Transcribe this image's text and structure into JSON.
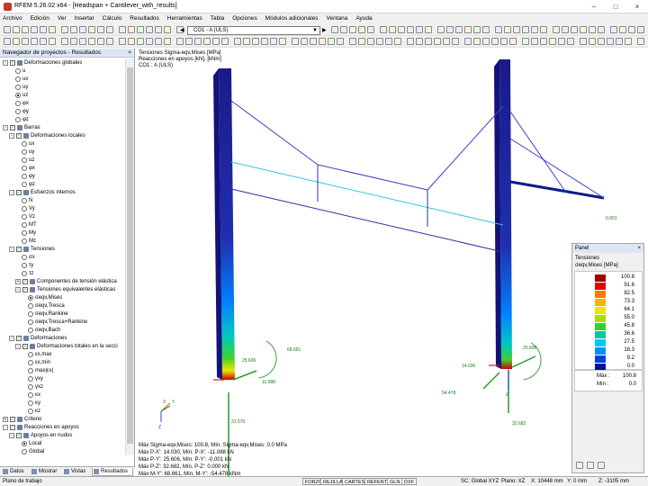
{
  "window": {
    "title": "RFEM 5.26.02 x64 - [Headspan + Cantilever_with_results]"
  },
  "menu": [
    "Archivo",
    "Edición",
    "Ver",
    "Insertar",
    "Cálculo",
    "Resultados",
    "Herramientas",
    "Tabla",
    "Opciones",
    "Módulos adicionales",
    "Ventana",
    "Ayuda"
  ],
  "toolbar": {
    "loadcase": "CO1 - A (ULS)"
  },
  "navigator": {
    "title": "Navegador de proyectos - Resultados",
    "items": [
      {
        "label": "Deformaciones globales",
        "level": 0,
        "exp": "-",
        "cb": true
      },
      {
        "label": "u",
        "level": 2,
        "radio": true
      },
      {
        "label": "ux",
        "level": 2,
        "radio": true
      },
      {
        "label": "uy",
        "level": 2,
        "radio": true
      },
      {
        "label": "uz",
        "level": 2,
        "radio": true,
        "on": true
      },
      {
        "label": "φx",
        "level": 2,
        "radio": true
      },
      {
        "label": "φy",
        "level": 2,
        "radio": true
      },
      {
        "label": "φz",
        "level": 2,
        "radio": true
      },
      {
        "label": "Barras",
        "level": 0,
        "exp": "-",
        "cb": true
      },
      {
        "label": "Deformaciones locales",
        "level": 1,
        "exp": "-",
        "cb": true
      },
      {
        "label": "ux",
        "level": 3,
        "radio": true
      },
      {
        "label": "uy",
        "level": 3,
        "radio": true
      },
      {
        "label": "uz",
        "level": 3,
        "radio": true
      },
      {
        "label": "φx",
        "level": 3,
        "radio": true
      },
      {
        "label": "φy",
        "level": 3,
        "radio": true
      },
      {
        "label": "φz",
        "level": 3,
        "radio": true
      },
      {
        "label": "Esfuerzos internos",
        "level": 1,
        "exp": "-",
        "cb": true
      },
      {
        "label": "N",
        "level": 3,
        "radio": true
      },
      {
        "label": "Vy",
        "level": 3,
        "radio": true
      },
      {
        "label": "Vz",
        "level": 3,
        "radio": true
      },
      {
        "label": "MT",
        "level": 3,
        "radio": true
      },
      {
        "label": "My",
        "level": 3,
        "radio": true
      },
      {
        "label": "Mz",
        "level": 3,
        "radio": true
      },
      {
        "label": "Tensiones",
        "level": 1,
        "exp": "-",
        "cb": true
      },
      {
        "label": "σx",
        "level": 3,
        "radio": true
      },
      {
        "label": "τy",
        "level": 3,
        "radio": true
      },
      {
        "label": "τz",
        "level": 3,
        "radio": true
      },
      {
        "label": "Componentes de tensión elástica",
        "level": 2,
        "exp": "+",
        "cb": true
      },
      {
        "label": "Tensiones equivalentes elásticas",
        "level": 2,
        "exp": "-",
        "cb": true
      },
      {
        "label": "σeqv,Mises",
        "level": 4,
        "radio": true,
        "on": true
      },
      {
        "label": "σeqv,Tresca",
        "level": 4,
        "radio": true
      },
      {
        "label": "σeqv,Rankine",
        "level": 4,
        "radio": true
      },
      {
        "label": "σeqv,Tresca+Rankine",
        "level": 4,
        "radio": true
      },
      {
        "label": "σeqv,Bach",
        "level": 4,
        "radio": true
      },
      {
        "label": "Deformaciones",
        "level": 1,
        "exp": "-",
        "cb": true
      },
      {
        "label": "Deformaciones totales en la secci",
        "level": 2,
        "exp": "-",
        "cb": true
      },
      {
        "label": "εx,max",
        "level": 4,
        "radio": true
      },
      {
        "label": "εx,min",
        "level": 4,
        "radio": true
      },
      {
        "label": "max|εx|",
        "level": 4,
        "radio": true
      },
      {
        "label": "γxy",
        "level": 4,
        "radio": true
      },
      {
        "label": "γxz",
        "level": 4,
        "radio": true
      },
      {
        "label": "κx",
        "level": 4,
        "radio": true
      },
      {
        "label": "κy",
        "level": 4,
        "radio": true
      },
      {
        "label": "κz",
        "level": 4,
        "radio": true
      },
      {
        "label": "Criterio",
        "level": 0,
        "exp": "+",
        "cb": true
      },
      {
        "label": "Reacciones en apoyos",
        "level": 0,
        "exp": "-",
        "cb": true
      },
      {
        "label": "Apoyos en nudos",
        "level": 1,
        "exp": "-",
        "cb": true
      },
      {
        "label": "Local",
        "level": 3,
        "radio": true,
        "on": true
      },
      {
        "label": "Global",
        "level": 3,
        "radio": true
      }
    ]
  },
  "navtabs": [
    "Datos",
    "Mostrar",
    "Vistas",
    "Resultados"
  ],
  "viewport": {
    "header": [
      "Tensiones Sigma-eqv,Mises [MPa]",
      "Reacciones en apoyos [kN], [kNm]",
      "CO1 : A (ULS)"
    ],
    "footer": [
      "Máx Sigma-eqv,Mises: 100.8, Mín. Sigma-eqv,Mises: 0.0 MPa",
      "Máx P-X': 14.030, Mín. P-X': -11.088 kN",
      "Máx P-Y': 25.606, Mín. P-Y': -0.001 kN",
      "Máx P-Z': 32.682, Mín. P-Z': 0.000 kN",
      "Máx M-Y': 68.661, Mín. M-Y': -54.478 kNm"
    ],
    "annotations": {
      "left_my": "68.661",
      "left_py": "25.606",
      "left_px": "11.088",
      "left_pz": "31.570",
      "right_py": "25.606",
      "right_px": "14.030",
      "right_my": "54.478",
      "right_pz": "32.682",
      "cable_end": "0.001"
    },
    "axes": {
      "x": "X",
      "y": "Y",
      "z": "Z"
    }
  },
  "panel": {
    "title": "Panel",
    "heading": "Tensiones",
    "unit": "σeqv,Mises [MPa]",
    "legend": [
      {
        "color": "#a00000",
        "value": "100.8"
      },
      {
        "color": "#e60000",
        "value": "91.6"
      },
      {
        "color": "#ff7a00",
        "value": "82.5"
      },
      {
        "color": "#ffb000",
        "value": "73.3"
      },
      {
        "color": "#e8e800",
        "value": "64.1"
      },
      {
        "color": "#a6e000",
        "value": "55.0"
      },
      {
        "color": "#30d030",
        "value": "45.8"
      },
      {
        "color": "#00c8a0",
        "value": "36.6"
      },
      {
        "color": "#00c8ff",
        "value": "27.5"
      },
      {
        "color": "#0090ff",
        "value": "18.3"
      },
      {
        "color": "#0040e0",
        "value": "9.2"
      },
      {
        "color": "#0010a0",
        "value": "0.0"
      }
    ],
    "max_label": "Máx :",
    "max_value": "100.8",
    "min_label": "Mín :",
    "min_value": "0.0"
  },
  "status": {
    "left": "Plano de trabajo",
    "buttons": [
      "FORZC",
      "REJILLA",
      "CARTES",
      "REFENT",
      "GLN",
      "DXF"
    ],
    "sc": "SC: Global XYZ",
    "plane": "Plano: XZ",
    "x": "X: 10448 mm",
    "y": "Y: 0 mm",
    "z": "Z: -3105 mm"
  }
}
